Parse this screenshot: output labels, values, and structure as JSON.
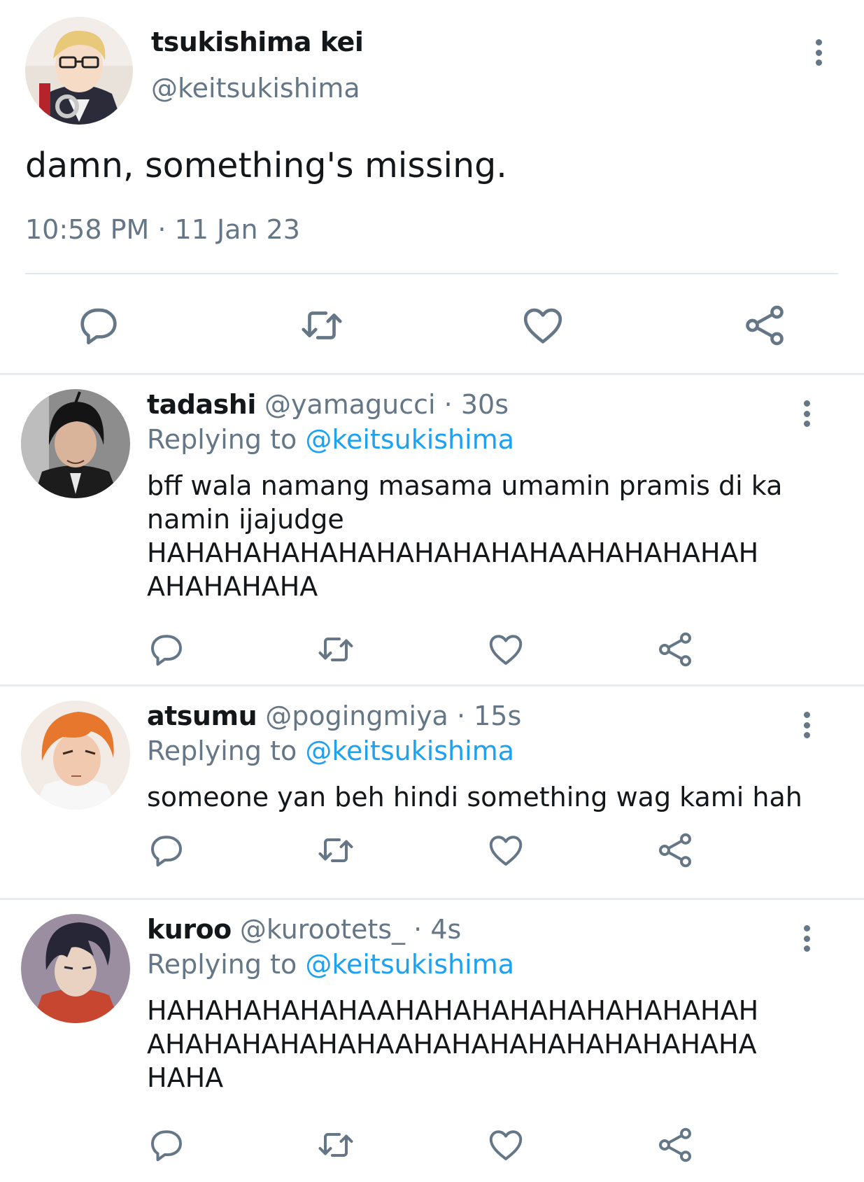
{
  "main_tweet": {
    "display_name": "tsukishima kei",
    "handle": "@keitsukishima",
    "text": "damn, something's missing.",
    "timestamp": "10:58 PM · 11 Jan 23",
    "actions": [
      "reply-icon",
      "retweet-icon",
      "like-icon",
      "share-icon"
    ]
  },
  "replies": [
    {
      "display_name": "tadashi",
      "handle": "@yamagucci",
      "dot": "·",
      "time": "30s",
      "replying_prefix": "Replying to",
      "replying_to": "@keitsukishima",
      "text_lines": [
        "bff wala namang masama umamin pramis di ka",
        "namin ijajudge",
        "HAHAHAHAHAHAHAHAHAHAHAAHAHAHAHAH",
        "AHAHAHAHA"
      ]
    },
    {
      "display_name": "atsumu",
      "handle": "@pogingmiya",
      "dot": "·",
      "time": "15s",
      "replying_prefix": "Replying to",
      "replying_to": "@keitsukishima",
      "text_lines": [
        "someone yan beh hindi something wag kami hah"
      ]
    },
    {
      "display_name": "kuroo",
      "handle": "@kurootets_",
      "dot": "·",
      "time": "4s",
      "replying_prefix": "Replying to",
      "replying_to": "@keitsukishima",
      "text_lines": [
        "HAHAHAHAHAHAAHAHAHAHAHAHAHAHAHAH",
        "AHAHAHAHAHAHAAHAHAHAHAHAHAHAHAHA",
        "HAHA"
      ]
    }
  ],
  "colors": {
    "text": "#14171a",
    "secondary": "#657786",
    "mention": "#1da1f2",
    "divider": "#e6ecf0"
  }
}
